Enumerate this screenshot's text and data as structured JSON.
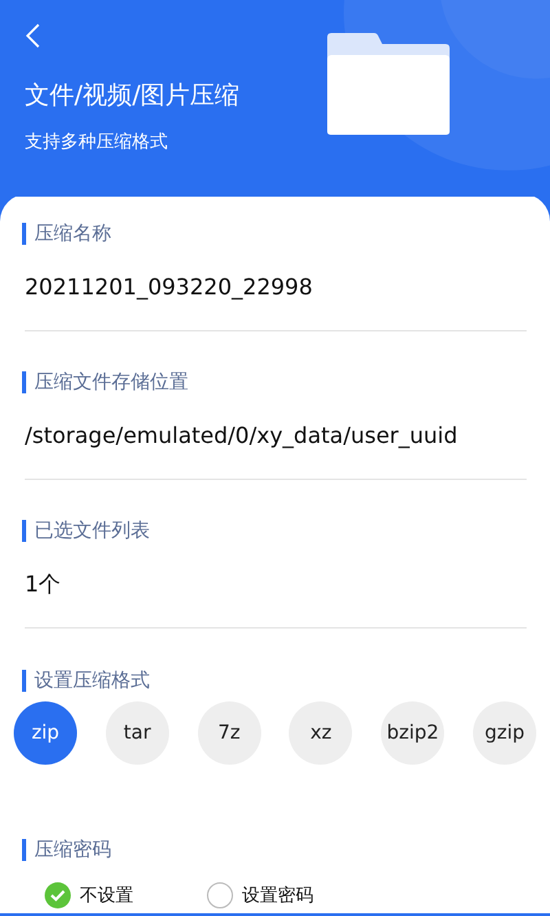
{
  "header": {
    "title": "文件/视频/图片压缩",
    "subtitle": "支持多种压缩格式"
  },
  "fields": [
    {
      "label": "压缩名称",
      "value": "20211201_093220_22998"
    },
    {
      "label": "压缩文件存储位置",
      "value": "/storage/emulated/0/xy_data/user_uuid"
    },
    {
      "label": "已选文件列表",
      "value": "1个"
    }
  ],
  "format": {
    "label": "设置压缩格式",
    "options": [
      {
        "label": "zip",
        "selected": true
      },
      {
        "label": "tar",
        "selected": false
      },
      {
        "label": "7z",
        "selected": false
      },
      {
        "label": "xz",
        "selected": false
      },
      {
        "label": "bzip2",
        "selected": false
      },
      {
        "label": "gzip",
        "selected": false
      }
    ]
  },
  "password": {
    "label": "压缩密码",
    "options": [
      {
        "label": "不设置",
        "selected": true
      },
      {
        "label": "设置密码",
        "selected": false
      }
    ]
  }
}
